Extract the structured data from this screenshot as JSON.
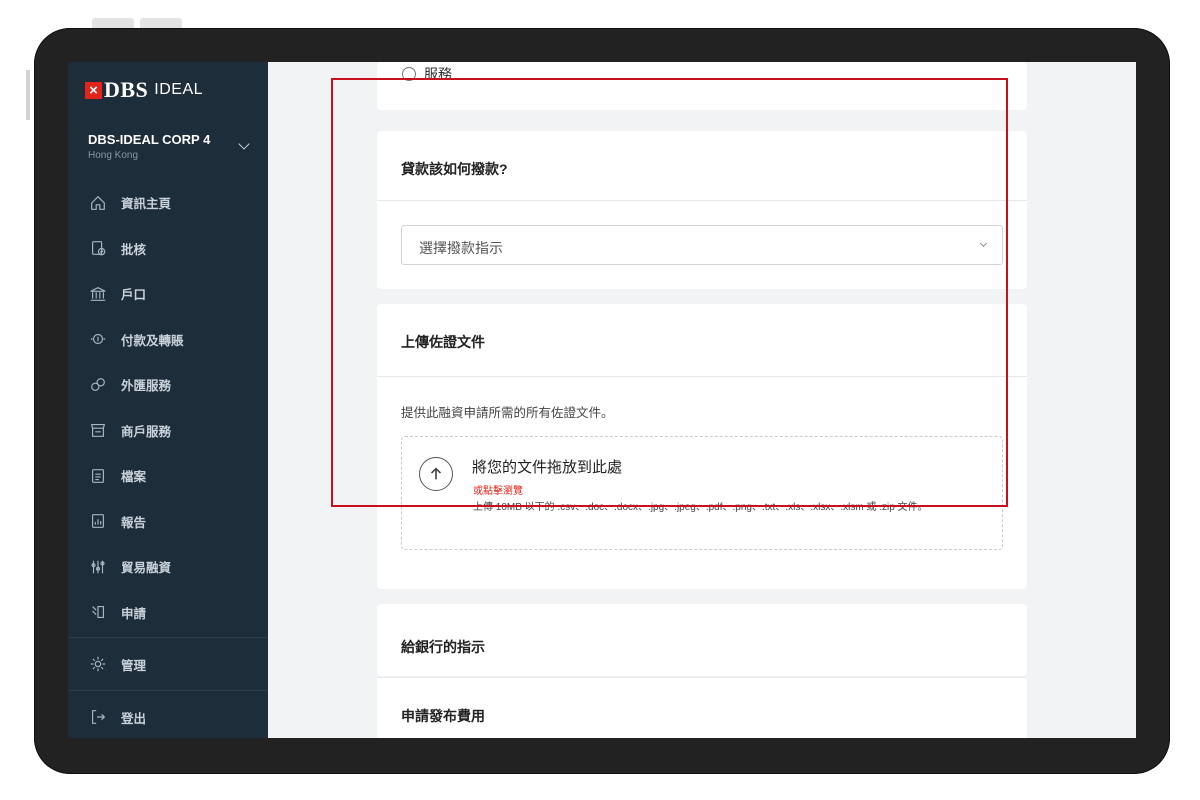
{
  "brand": {
    "logo_mark": "×",
    "logo_dbs": "DBS",
    "logo_ideal": "IDEAL",
    "accent_color": "#e2231a",
    "sidebar_color": "#1e2d3a"
  },
  "account": {
    "name": "DBS-IDEAL CORP 4",
    "region": "Hong Kong"
  },
  "sidebar": {
    "items": [
      {
        "label": "資訊主頁",
        "icon": "home-icon"
      },
      {
        "label": "批核",
        "icon": "approval-icon"
      },
      {
        "label": "戶口",
        "icon": "bank-icon"
      },
      {
        "label": "付款及轉賬",
        "icon": "payment-icon"
      },
      {
        "label": "外匯服務",
        "icon": "fx-icon"
      },
      {
        "label": "商戶服務",
        "icon": "merchant-icon"
      },
      {
        "label": "檔案",
        "icon": "file-icon"
      },
      {
        "label": "報告",
        "icon": "report-icon"
      },
      {
        "label": "貿易融資",
        "icon": "trade-icon"
      },
      {
        "label": "申請",
        "icon": "apply-icon"
      }
    ],
    "bottom": [
      {
        "label": "管理",
        "icon": "gear-icon"
      },
      {
        "label": "登出",
        "icon": "logout-icon"
      }
    ]
  },
  "main": {
    "radio_option": "服務",
    "disbursement": {
      "title": "貸款該如何撥款?",
      "select_placeholder": "選擇撥款指示"
    },
    "upload": {
      "title": "上傳佐證文件",
      "description": "提供此融資申請所需的所有佐證文件。",
      "drop_title": "將您的文件拖放到此處",
      "browse_link": "或點擊瀏覽",
      "note": "上傳 10MB 以下的 .csv、.doc、.docx、.jpg、.jpeg、.pdf、.png、.txt、.xls、.xlsx、.xlsm 或 .zip 文件。"
    },
    "bank_instructions_title": "給銀行的指示",
    "fee_title": "申請發布費用"
  },
  "highlight_color": "#c8101e"
}
